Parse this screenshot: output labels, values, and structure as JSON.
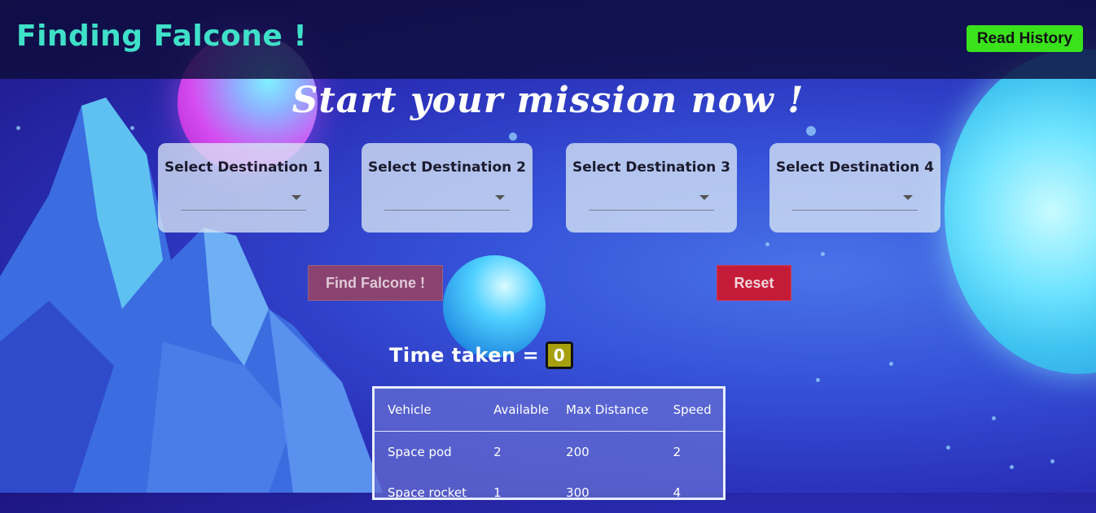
{
  "header": {
    "brand": "Finding Falcone !",
    "history_button": "Read History"
  },
  "heading": "Start your mission now !",
  "destinations": [
    {
      "label": "Select Destination 1",
      "value": ""
    },
    {
      "label": "Select Destination 2",
      "value": ""
    },
    {
      "label": "Select Destination 3",
      "value": ""
    },
    {
      "label": "Select Destination 4",
      "value": ""
    }
  ],
  "actions": {
    "find_label": "Find Falcone !",
    "reset_label": "Reset"
  },
  "time": {
    "label": "Time taken",
    "equals": "=",
    "value": "0"
  },
  "vehicles": {
    "columns": [
      "Vehicle",
      "Available",
      "Max Distance",
      "Speed"
    ],
    "rows": [
      {
        "name": "Space pod",
        "available": "2",
        "max_distance": "200",
        "speed": "2"
      },
      {
        "name": "Space rocket",
        "available": "1",
        "max_distance": "300",
        "speed": "4"
      }
    ]
  },
  "colors": {
    "brand": "#3fe0c8",
    "history_button": "#3ae21c",
    "find_button": "#8a4370",
    "reset_button": "#c41c38",
    "time_badge": "#a6a00f"
  }
}
